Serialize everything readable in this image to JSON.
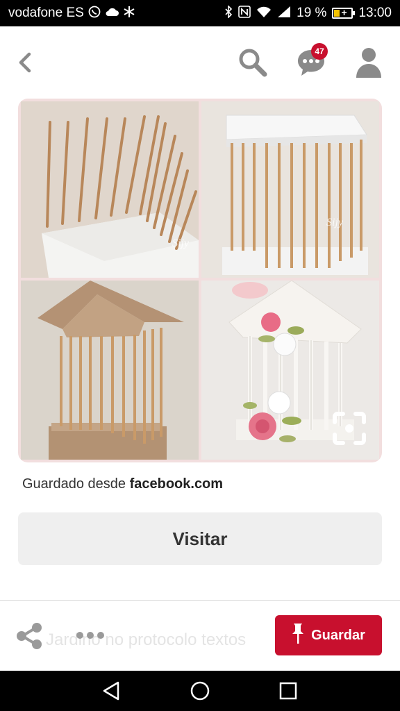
{
  "status_bar": {
    "carrier": "vodafone ES",
    "battery": "19 %",
    "time": "13:00",
    "icons": [
      "whatsapp-icon",
      "cloud-icon",
      "asterisk-icon",
      "bluetooth-icon",
      "nfc-icon",
      "wifi-icon",
      "signal-icon",
      "battery-icon"
    ]
  },
  "header": {
    "notifications_count": "47",
    "icons": [
      "back-arrow-icon",
      "search-icon",
      "chat-bubble-icon",
      "profile-icon"
    ]
  },
  "pin": {
    "image_description_icons": [
      "zoom-lens-icon"
    ],
    "watermark": "Sijy"
  },
  "source": {
    "prefix": "Guardado desde",
    "domain": "facebook.com"
  },
  "actions": {
    "visit_label": "Visitar",
    "save_label": "Guardar",
    "ghost_text": "Jardino no protocolo textos"
  },
  "colors": {
    "accent": "#c8102e",
    "button_gray": "#efefef"
  },
  "navbar": {
    "icons": [
      "back-triangle-icon",
      "home-circle-icon",
      "recents-square-icon"
    ]
  }
}
